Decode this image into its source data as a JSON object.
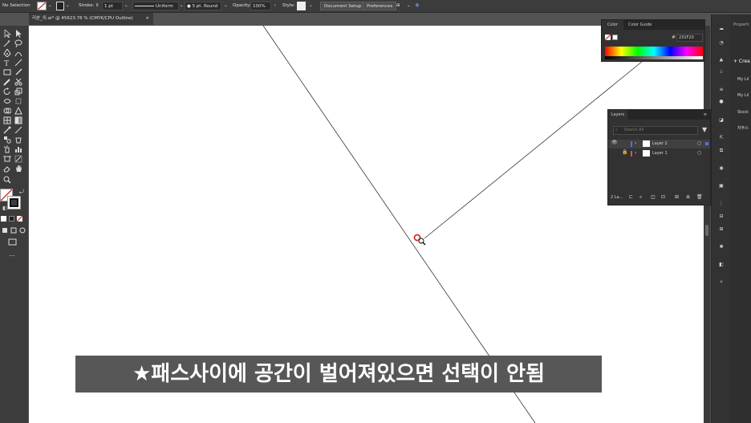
{
  "control_bar": {
    "selection_status": "No Selection",
    "stroke_label": "Stroke:",
    "stroke_weight": "1 pt",
    "stroke_profile": "Uniform",
    "brush": "5 pt. Round",
    "opacity_label": "Opacity:",
    "opacity_value": "100%",
    "style_label": "Style:",
    "document_setup": "Document Setup",
    "preferences": "Preferences"
  },
  "document_tab": {
    "title": "리본_외.ai* @ 45623.76 % (CMYK/CPU Outline)",
    "close": "×"
  },
  "color_panel": {
    "tab_color": "Color",
    "tab_color_guide": "Color Guide",
    "hex_value": "231F20",
    "hex_prefix": "#"
  },
  "layers_panel": {
    "title": "Layers",
    "search_placeholder": "Search All",
    "layers": [
      {
        "name": "Layer 2",
        "color": "#4f6cff"
      },
      {
        "name": "Layer 1",
        "color": "#e84b4b"
      }
    ],
    "footer_count": "2 La..."
  },
  "properties_panel": {
    "title": "Properti",
    "create_label": "+ Crea",
    "items": [
      "My Lil",
      "My Lil",
      "Stock",
      "자주스"
    ]
  },
  "subtitle": "★패스사이에 공간이 벌어져있으면 선택이 안됨",
  "colors": {
    "accent_red": "#d23232",
    "selection_blue": "#4f6cff"
  }
}
